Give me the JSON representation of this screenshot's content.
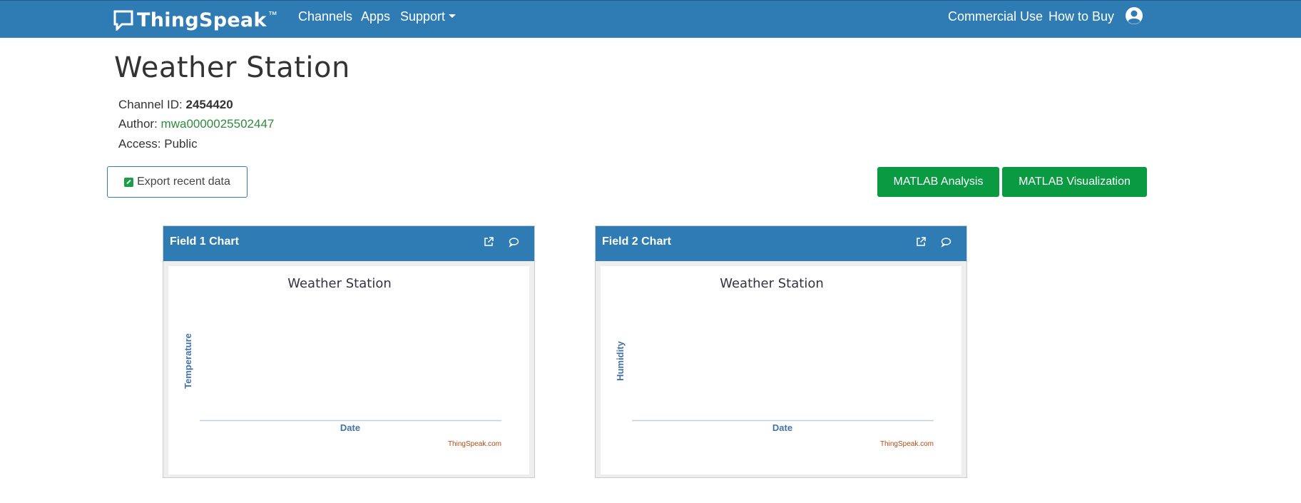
{
  "nav": {
    "brand": "ThingSpeak",
    "brand_tm": "™",
    "links": [
      "Channels",
      "Apps",
      "Support"
    ],
    "right_links": [
      "Commercial Use",
      "How to Buy"
    ]
  },
  "page": {
    "title": "Weather Station",
    "channel_id_label": "Channel ID:",
    "channel_id": "2454420",
    "author_label": "Author:",
    "author": "mwa0000025502447",
    "access_label": "Access:",
    "access": "Public"
  },
  "buttons": {
    "export": "Export recent data",
    "matlab_analysis": "MATLAB Analysis",
    "matlab_visualization": "MATLAB Visualization"
  },
  "charts": [
    {
      "panel_title": "Field 1 Chart",
      "title": "Weather Station",
      "ylabel": "Temperature",
      "xlabel": "Date",
      "credit": "ThingSpeak.com"
    },
    {
      "panel_title": "Field 2 Chart",
      "title": "Weather Station",
      "ylabel": "Humidity",
      "xlabel": "Date",
      "credit": "ThingSpeak.com"
    }
  ],
  "colors": {
    "nav": "#2f7cb4",
    "green": "#0a9a41",
    "link": "#2e8b3e",
    "credit": "#b04a1a"
  }
}
